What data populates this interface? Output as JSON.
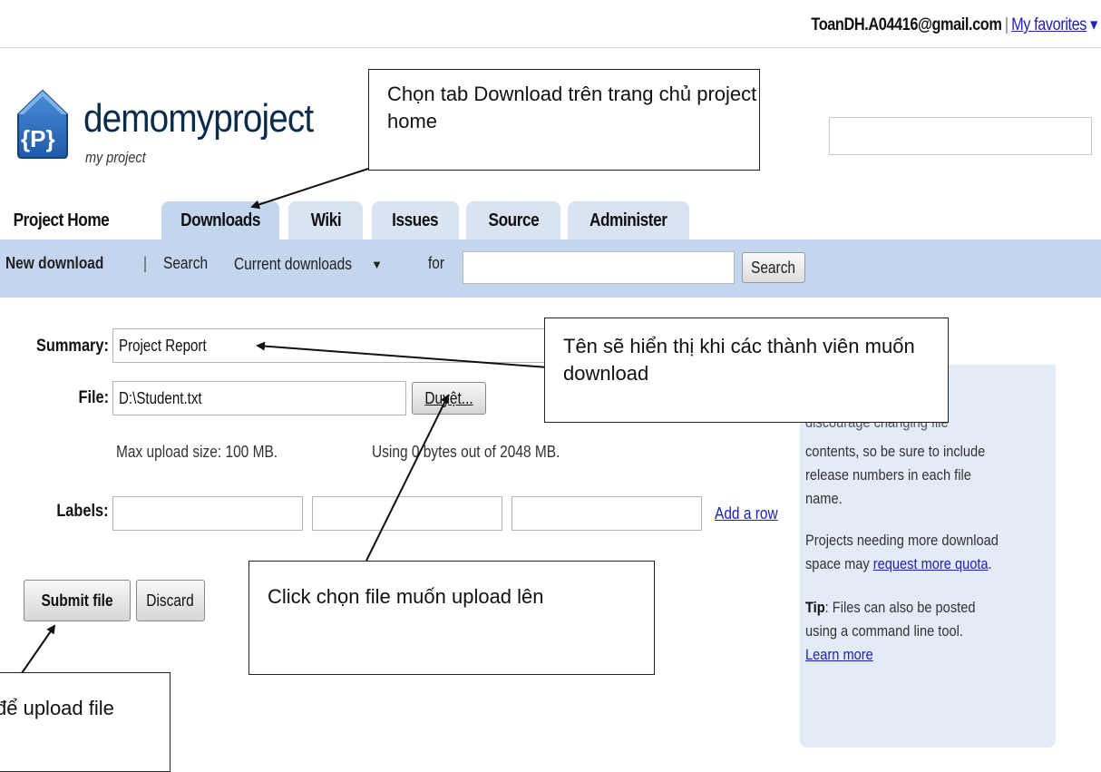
{
  "userbar": {
    "email": "ToanDH.A04416@gmail.com",
    "separator": "|",
    "favorites_link": "My favorites",
    "favorites_arrow": "▾"
  },
  "project": {
    "name": "demomyproject",
    "subtitle": "my project",
    "logo_letter": "{P}"
  },
  "tabs": [
    {
      "label": "Project Home",
      "active": false
    },
    {
      "label": "Downloads",
      "active": true
    },
    {
      "label": "Wiki",
      "active": false
    },
    {
      "label": "Issues",
      "active": false
    },
    {
      "label": "Source",
      "active": false
    },
    {
      "label": "Administer",
      "active": false
    }
  ],
  "subbar": {
    "new_download": "New download",
    "separator": "|",
    "search_label": "Search",
    "scope_value": "Current downloads",
    "for_label": "for",
    "query_value": "",
    "search_button": "Search"
  },
  "form": {
    "summary_label": "Summary:",
    "summary_value": "Project Report",
    "file_label": "File:",
    "file_value": "D:\\Student.txt",
    "browse_button": "Duyệt...",
    "max_upload": "Max upload size: 100 MB.",
    "usage": "Using 0 bytes out of 2048 MB.",
    "labels_label": "Labels:",
    "add_row": "Add a row",
    "submit_button": "Submit file",
    "discard_button": "Discard"
  },
  "sidebar": {
    "p1_line0": "discourage changing file",
    "p1_line1": "contents, so be sure to include",
    "p1_line2": "release numbers in each file",
    "p1_line3": "name.",
    "p2_line1": "Projects needing more download",
    "p2_line2_prefix": "space may ",
    "p2_link": "request more quota",
    "p2_line2_suffix": ".",
    "tip_bold": "Tip",
    "tip_rest": ": Files can also be posted",
    "tip_line2": "using a command line tool.",
    "learn_more": "Learn more"
  },
  "callouts": {
    "downloads_tab": "Chọn tab Download trên trang chủ project home",
    "summary": "Tên sẽ hiển thị khi các thành viên muốn download",
    "browse": "Click chọn file muốn upload lên",
    "submit": "để upload file"
  },
  "colors": {
    "toolbar_bg": "#c3d6ee",
    "tab_bg": "#d9e3f2",
    "sidebar_bg": "#e3ebf6",
    "link": "#2020c0"
  }
}
